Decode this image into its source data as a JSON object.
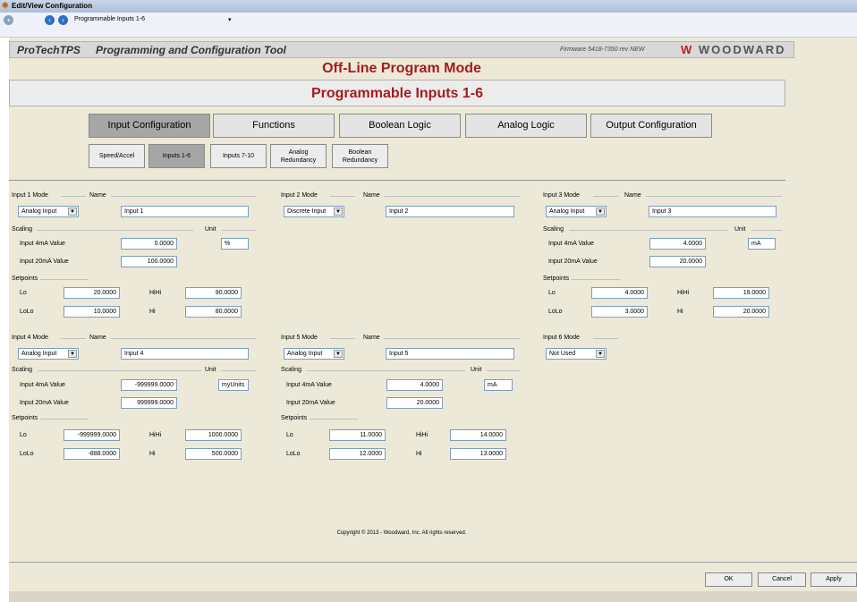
{
  "window": {
    "title": "Edit/View Configuration"
  },
  "toolbar": {
    "location": "Programmable Inputs 1-6"
  },
  "header": {
    "app_name": "ProTechTPS",
    "tool_name": "Programming and Configuration Tool",
    "firmware": "Firmware 5418-7350 rev NEW",
    "brand": "WOODWARD"
  },
  "mode_title": "Off-Line Program Mode",
  "page_title": "Programmable Inputs 1-6",
  "main_tabs": [
    "Input Configuration",
    "Functions",
    "Boolean Logic",
    "Analog Logic",
    "Output Configuration"
  ],
  "sub_tabs": [
    "Speed/Accel",
    "Inputs 1-6",
    "Inputs 7-10",
    "Analog Redundancy",
    "Boolean Redundancy"
  ],
  "labels": {
    "name": "Name",
    "scaling": "Scaling",
    "unit": "Unit",
    "v4": "Input 4mA Value",
    "v20": "Input 20mA Value",
    "setpoints": "Setpoints",
    "lo": "Lo",
    "lolo": "LoLo",
    "hi": "Hi",
    "hihi": "HiHi"
  },
  "inputs": [
    {
      "mode_label": "Input 1 Mode",
      "mode": "Analog Input",
      "name": "Input 1",
      "v4": "0.0000",
      "v20": "100.0000",
      "unit": "%",
      "lo": "20.0000",
      "lolo": "10.0000",
      "hi": "80.0000",
      "hihi": "90.0000"
    },
    {
      "mode_label": "Input 2 Mode",
      "mode": "Discrete Input",
      "name": "Input 2"
    },
    {
      "mode_label": "Input 3 Mode",
      "mode": "Analog Input",
      "name": "Input 3",
      "v4": "4.0000",
      "v20": "20.0000",
      "unit": "mA",
      "lo": "4.0000",
      "lolo": "3.0000",
      "hi": "20.0000",
      "hihi": "19.0000"
    },
    {
      "mode_label": "Input 4 Mode",
      "mode": "Analog Input",
      "name": "Input 4",
      "v4": "-999999.0000",
      "v20": "999999.0000",
      "unit": "myUnits",
      "lo": "-999999.0000",
      "lolo": "-888.0000",
      "hi": "500.0000",
      "hihi": "1000.0000"
    },
    {
      "mode_label": "Input 5 Mode",
      "mode": "Analog Input",
      "name": "Input 5",
      "v4": "4.0000",
      "v20": "20.0000",
      "unit": "mA",
      "lo": "11.0000",
      "lolo": "12.0000",
      "hi": "13.0000",
      "hihi": "14.0000"
    },
    {
      "mode_label": "Input 6 Mode",
      "mode": "Not Used"
    }
  ],
  "copyright": "Copyright © 2013 - Woodward, Inc. All rights reserved.",
  "buttons": {
    "ok": "OK",
    "cancel": "Cancel",
    "apply": "Apply"
  }
}
